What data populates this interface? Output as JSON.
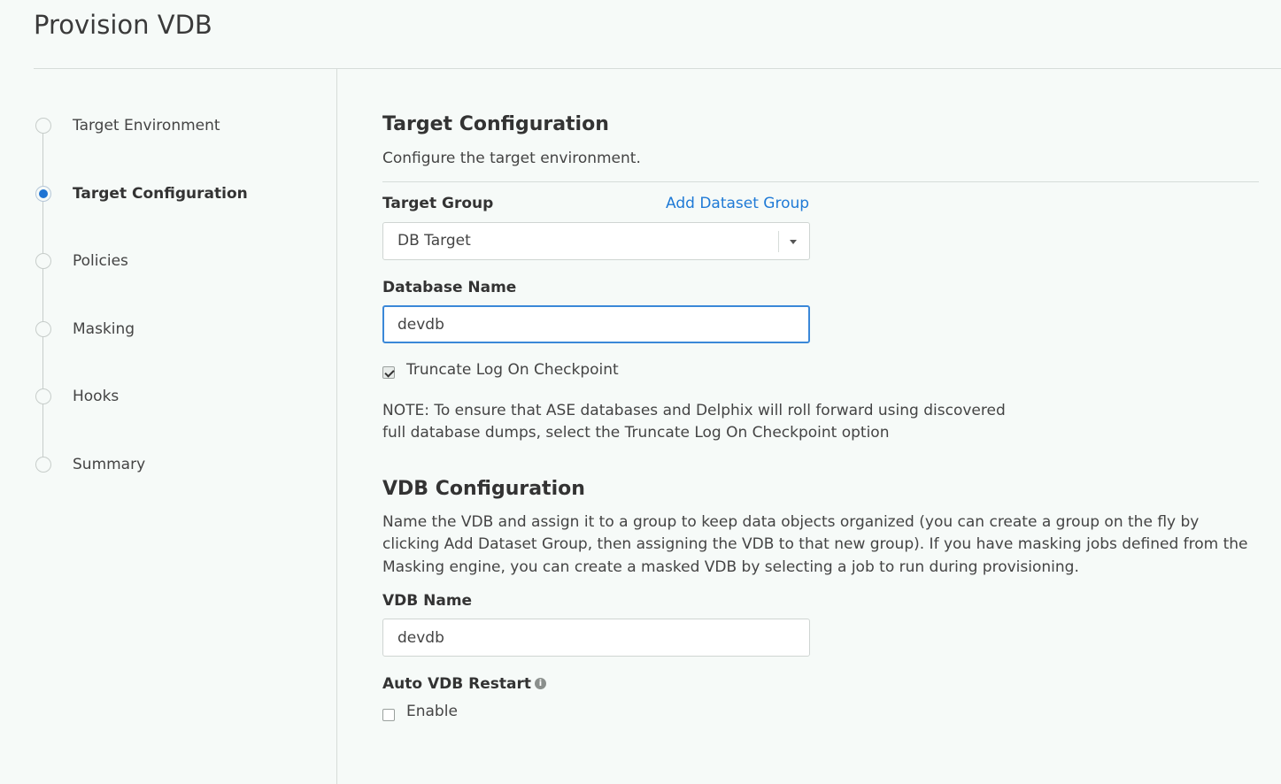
{
  "page": {
    "title": "Provision VDB"
  },
  "steps": [
    {
      "label": "Target Environment",
      "active": false
    },
    {
      "label": "Target Configuration",
      "active": true
    },
    {
      "label": "Policies",
      "active": false
    },
    {
      "label": "Masking",
      "active": false
    },
    {
      "label": "Hooks",
      "active": false
    },
    {
      "label": "Summary",
      "active": false
    }
  ],
  "target_config": {
    "heading": "Target Configuration",
    "description": "Configure the target environment.",
    "target_group_label": "Target Group",
    "add_group_link": "Add Dataset Group",
    "target_group_value": "DB Target",
    "database_name_label": "Database Name",
    "database_name_value": "devdb",
    "truncate_label": "Truncate Log On Checkpoint",
    "truncate_checked": true,
    "note_line1": "NOTE: To ensure that ASE databases and Delphix will roll forward using discovered",
    "note_line2": "full database dumps, select the Truncate Log On Checkpoint option"
  },
  "vdb_config": {
    "heading": "VDB Configuration",
    "desc_line1": "Name the VDB and assign it to a group to keep data objects organized (you can create a group on the fly by",
    "desc_line2": "clicking Add Dataset Group, then assigning the VDB to that new group). If you have masking jobs defined from the",
    "desc_line3": "Masking engine, you can create a masked VDB by selecting a job to run during provisioning.",
    "vdb_name_label": "VDB Name",
    "vdb_name_value": "devdb",
    "auto_restart_label": "Auto VDB Restart",
    "enable_label": "Enable",
    "enable_checked": false
  },
  "colors": {
    "accent": "#1f74d3",
    "link": "#1f7ad6",
    "background": "#f6faf8"
  },
  "icons": {
    "info": "info-icon",
    "dropdown": "caret-down-icon"
  }
}
